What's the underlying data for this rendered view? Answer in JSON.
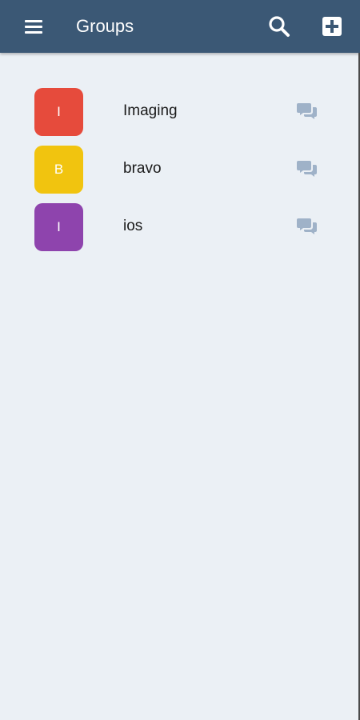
{
  "header": {
    "title": "Groups",
    "background": "#3b5875",
    "menu_icon": "hamburger-menu-icon",
    "search_icon": "search-icon",
    "add_icon": "plus-square-icon"
  },
  "groups": [
    {
      "initial": "I",
      "name": "Imaging",
      "color": "#e64b3c",
      "chat_icon": "chat-bubbles-icon"
    },
    {
      "initial": "B",
      "name": "bravo",
      "color": "#f1c40f",
      "chat_icon": "chat-bubbles-icon"
    },
    {
      "initial": "I",
      "name": "ios",
      "color": "#8e44ad",
      "chat_icon": "chat-bubbles-icon"
    }
  ],
  "colors": {
    "background": "#ebf0f5",
    "chat_icon": "#9fb2c8"
  }
}
